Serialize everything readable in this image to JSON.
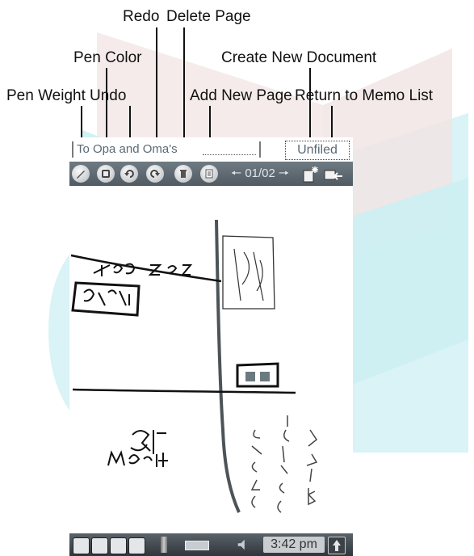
{
  "callouts": {
    "redo": "Redo",
    "delete_page": "Delete Page",
    "pen_color": "Pen Color",
    "create_new_document": "Create New Document",
    "pen_weight": "Pen Weight",
    "undo": "Undo",
    "add_new_page": "Add New Page",
    "return_to_memo_list": "Return to Memo List"
  },
  "note": {
    "title": "To Opa and Oma's",
    "category": "Unfiled"
  },
  "toolbar": {
    "buttons": [
      {
        "name": "pen-weight",
        "icon": "pen-weight-icon"
      },
      {
        "name": "pen-color",
        "icon": "pen-color-icon"
      },
      {
        "name": "undo",
        "icon": "undo-icon"
      },
      {
        "name": "redo",
        "icon": "redo-icon"
      },
      {
        "name": "delete-page",
        "icon": "trash-icon"
      },
      {
        "name": "add-new-page",
        "icon": "add-page-icon"
      }
    ],
    "page_indicator": "01/02",
    "create_icon": "new-document-icon",
    "return_icon": "return-to-list-icon"
  },
  "status_bar": {
    "time": "3:42 pm",
    "icons": [
      "home-icon",
      "menu-icon",
      "find-icon",
      "keyboard-icon",
      "signal-icon",
      "battery-icon",
      "volume-icon",
      "up-arrow-icon"
    ]
  },
  "colors": {
    "toolbar": "#5f6a72",
    "status_bar": "#3a4248",
    "watermark": "#b9e8ee"
  }
}
